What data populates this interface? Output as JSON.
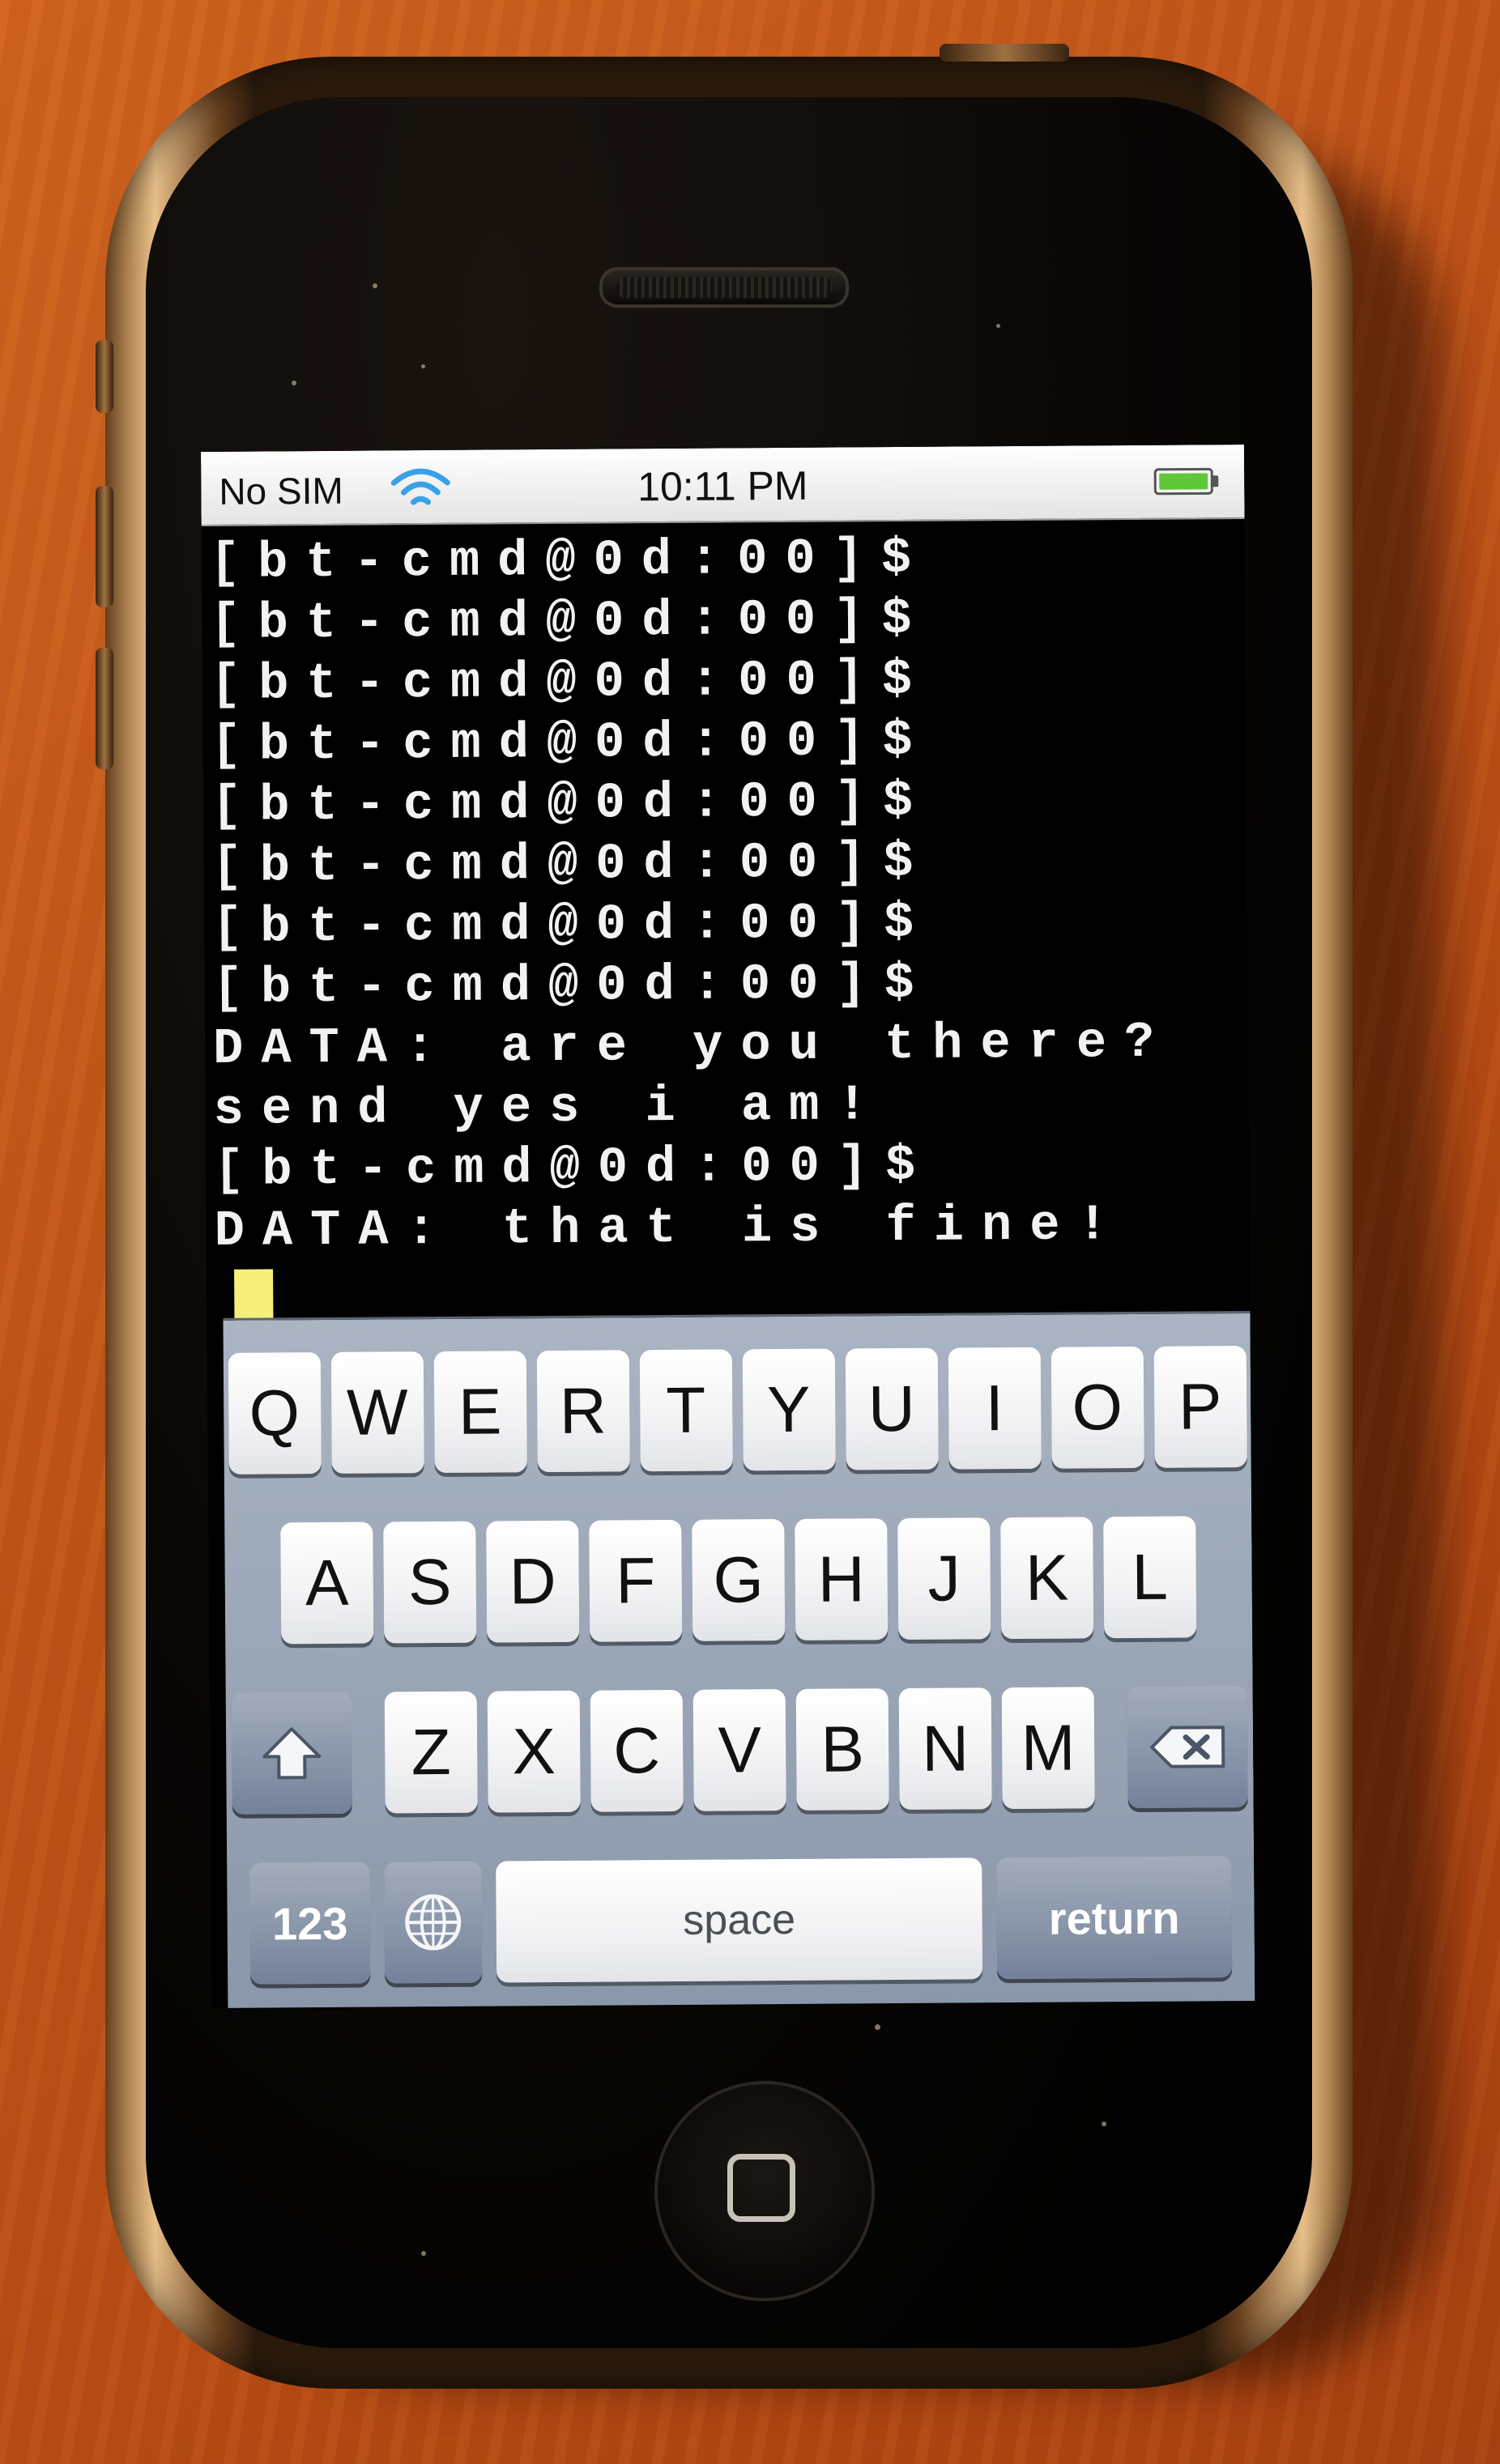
{
  "status_bar": {
    "carrier": "No SIM",
    "wifi_icon": "wifi-icon",
    "time": "10:11 PM",
    "battery_icon": "battery-icon"
  },
  "terminal": {
    "lines": [
      "[bt-cmd@0d:00]$",
      "[bt-cmd@0d:00]$",
      "[bt-cmd@0d:00]$",
      "[bt-cmd@0d:00]$",
      "[bt-cmd@0d:00]$",
      "[bt-cmd@0d:00]$",
      "[bt-cmd@0d:00]$",
      "[bt-cmd@0d:00]$",
      "DATA: are you there?",
      "send yes i am!",
      "[bt-cmd@0d:00]$",
      "DATA: that is fine!"
    ],
    "cursor_color": "#f6f07a"
  },
  "keyboard": {
    "row1": [
      "Q",
      "W",
      "E",
      "R",
      "T",
      "Y",
      "U",
      "I",
      "O",
      "P"
    ],
    "row2": [
      "A",
      "S",
      "D",
      "F",
      "G",
      "H",
      "J",
      "K",
      "L"
    ],
    "row3": [
      "Z",
      "X",
      "C",
      "V",
      "B",
      "N",
      "M"
    ],
    "shift_icon": "shift-icon",
    "backspace_icon": "backspace-icon",
    "numbers_label": "123",
    "globe_icon": "globe-icon",
    "space_label": "space",
    "return_label": "return"
  }
}
